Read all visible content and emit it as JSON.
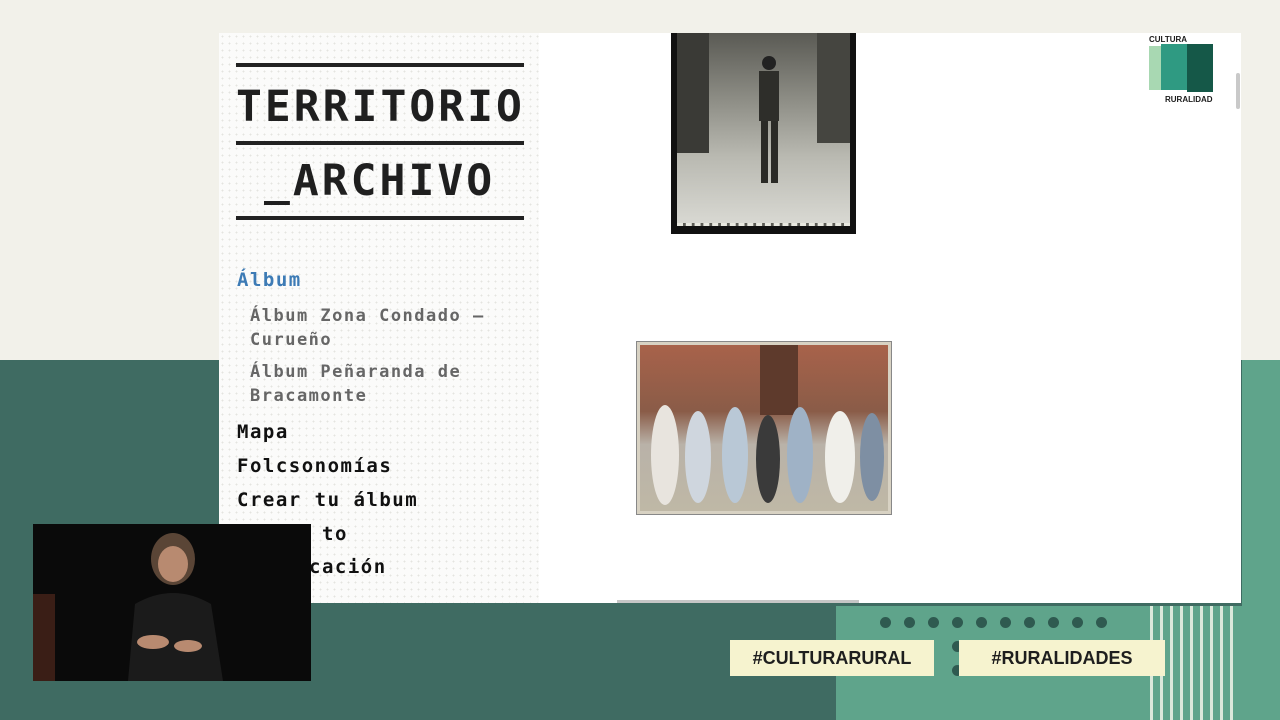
{
  "site": {
    "logo_line1": "TERRITORIO",
    "logo_line2": "_ARCHIVO"
  },
  "nav": {
    "active": "Álbum",
    "sub_items": [
      {
        "line1": "Álbum Zona Condado –",
        "line2": "Curueño"
      },
      {
        "line1": "Álbum Peñaranda de",
        "line2": "Bracamonte"
      }
    ],
    "items": [
      "Mapa",
      "Folcsonomías",
      "Crear tu álbum",
      "to",
      "cación"
    ]
  },
  "badge": {
    "top_word": "CULTURA",
    "bottom_word": "RURALIDAD",
    "colors": {
      "light": "#a8d8b2",
      "mid": "#2f9a82",
      "dark": "#155848"
    }
  },
  "hashtags": [
    "#CULTURARURAL",
    "#RURALIDADES"
  ],
  "colors": {
    "accent": "#3d7bb5",
    "background_top": "#f2f1ea",
    "background_bottom": "#3f6b62",
    "green_light": "#5fa48b",
    "hashtag_bg": "#f6f3cf"
  }
}
